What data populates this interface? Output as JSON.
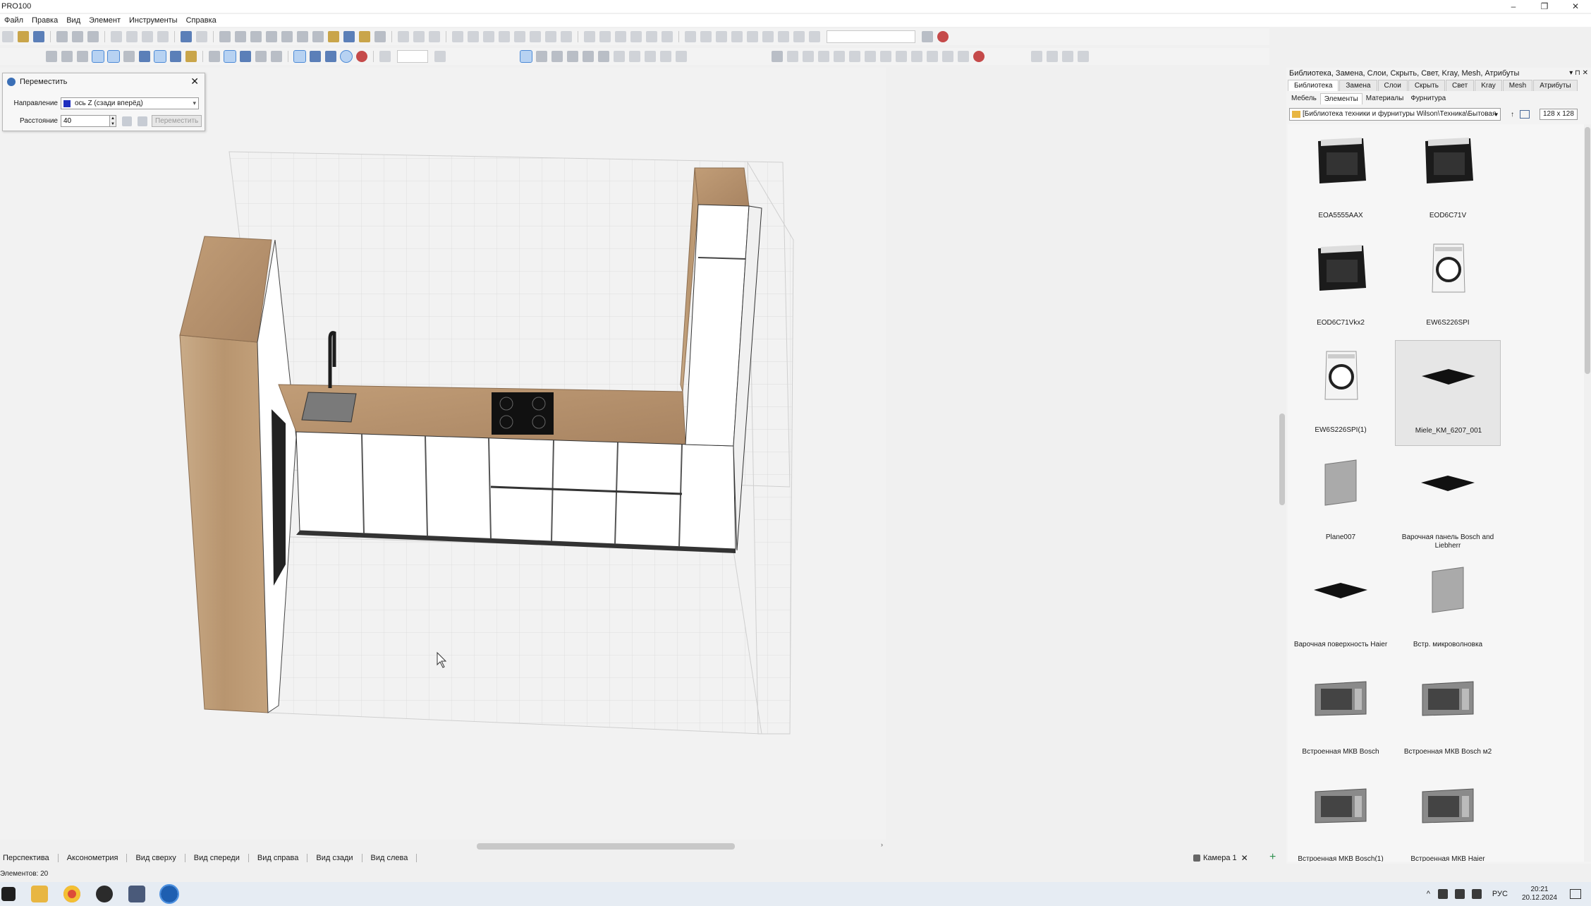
{
  "window": {
    "title": "PRO100",
    "controls": [
      "–",
      "❐",
      "✕"
    ]
  },
  "menu": [
    "Файл",
    "Правка",
    "Вид",
    "Элемент",
    "Инструменты",
    "Справка"
  ],
  "move_dialog": {
    "title": "Переместить",
    "direction_label": "Направление",
    "direction_value": "ось Z (сзади вперёд)",
    "distance_label": "Расстояние",
    "distance_value": "40",
    "apply_label": "Переместить",
    "direction_color": "#1f2fbf"
  },
  "view_tabs": [
    "Перспектива",
    "Аксонометрия",
    "Вид сверху",
    "Вид спереди",
    "Вид справа",
    "Вид сзади",
    "Вид слева"
  ],
  "camera_tab": "Камера 1",
  "status": {
    "elements_text": "Элементов: 20"
  },
  "right_panel": {
    "header": "Библиотека, Замена, Слои, Скрыть, Свет, Kray, Mesh, Атрибуты",
    "tabs": [
      "Библиотека",
      "Замена",
      "Слои",
      "Скрыть",
      "Свет",
      "Kray",
      "Mesh",
      "Атрибуты"
    ],
    "subtabs": [
      "Мебель",
      "Элементы",
      "Материалы",
      "Фурнитура"
    ],
    "selected_subtab": "Элементы",
    "path": "[Библиотека техники и фурнитуры Wilson\\Техника\\Бытовая",
    "thumb_size": "128 x 128",
    "items": [
      {
        "name": "EOA5555AAX",
        "icon": "oven-icon"
      },
      {
        "name": "EOD6C71V",
        "icon": "oven-icon"
      },
      {
        "name": "EOD6C71Vkx2",
        "icon": "oven-icon"
      },
      {
        "name": "EW6S226SPI",
        "icon": "washing-machine-icon"
      },
      {
        "name": "EW6S226SPI(1)",
        "icon": "washing-machine-icon"
      },
      {
        "name": "Miele_KM_6207_001",
        "icon": "cooktop-icon",
        "selected": true
      },
      {
        "name": "Plane007",
        "icon": "plane-icon"
      },
      {
        "name": "Варочная панель Bosch and Liebherr",
        "icon": "cooktop-icon"
      },
      {
        "name": "Варочная поверхность Haier",
        "icon": "cooktop-icon"
      },
      {
        "name": "Встр. микроволновка",
        "icon": "plane-icon"
      },
      {
        "name": "Встроенная МКВ Bosch",
        "icon": "microwave-icon"
      },
      {
        "name": "Встроенная МКВ Bosch м2",
        "icon": "microwave-icon"
      },
      {
        "name": "Встроенная МКВ Bosch(1)",
        "icon": "microwave-icon"
      },
      {
        "name": "Встроенная МКВ Haier",
        "icon": "microwave-icon"
      }
    ]
  },
  "taskbar": {
    "lang": "РУС",
    "time": "20:21",
    "date": "20.12.2024"
  }
}
